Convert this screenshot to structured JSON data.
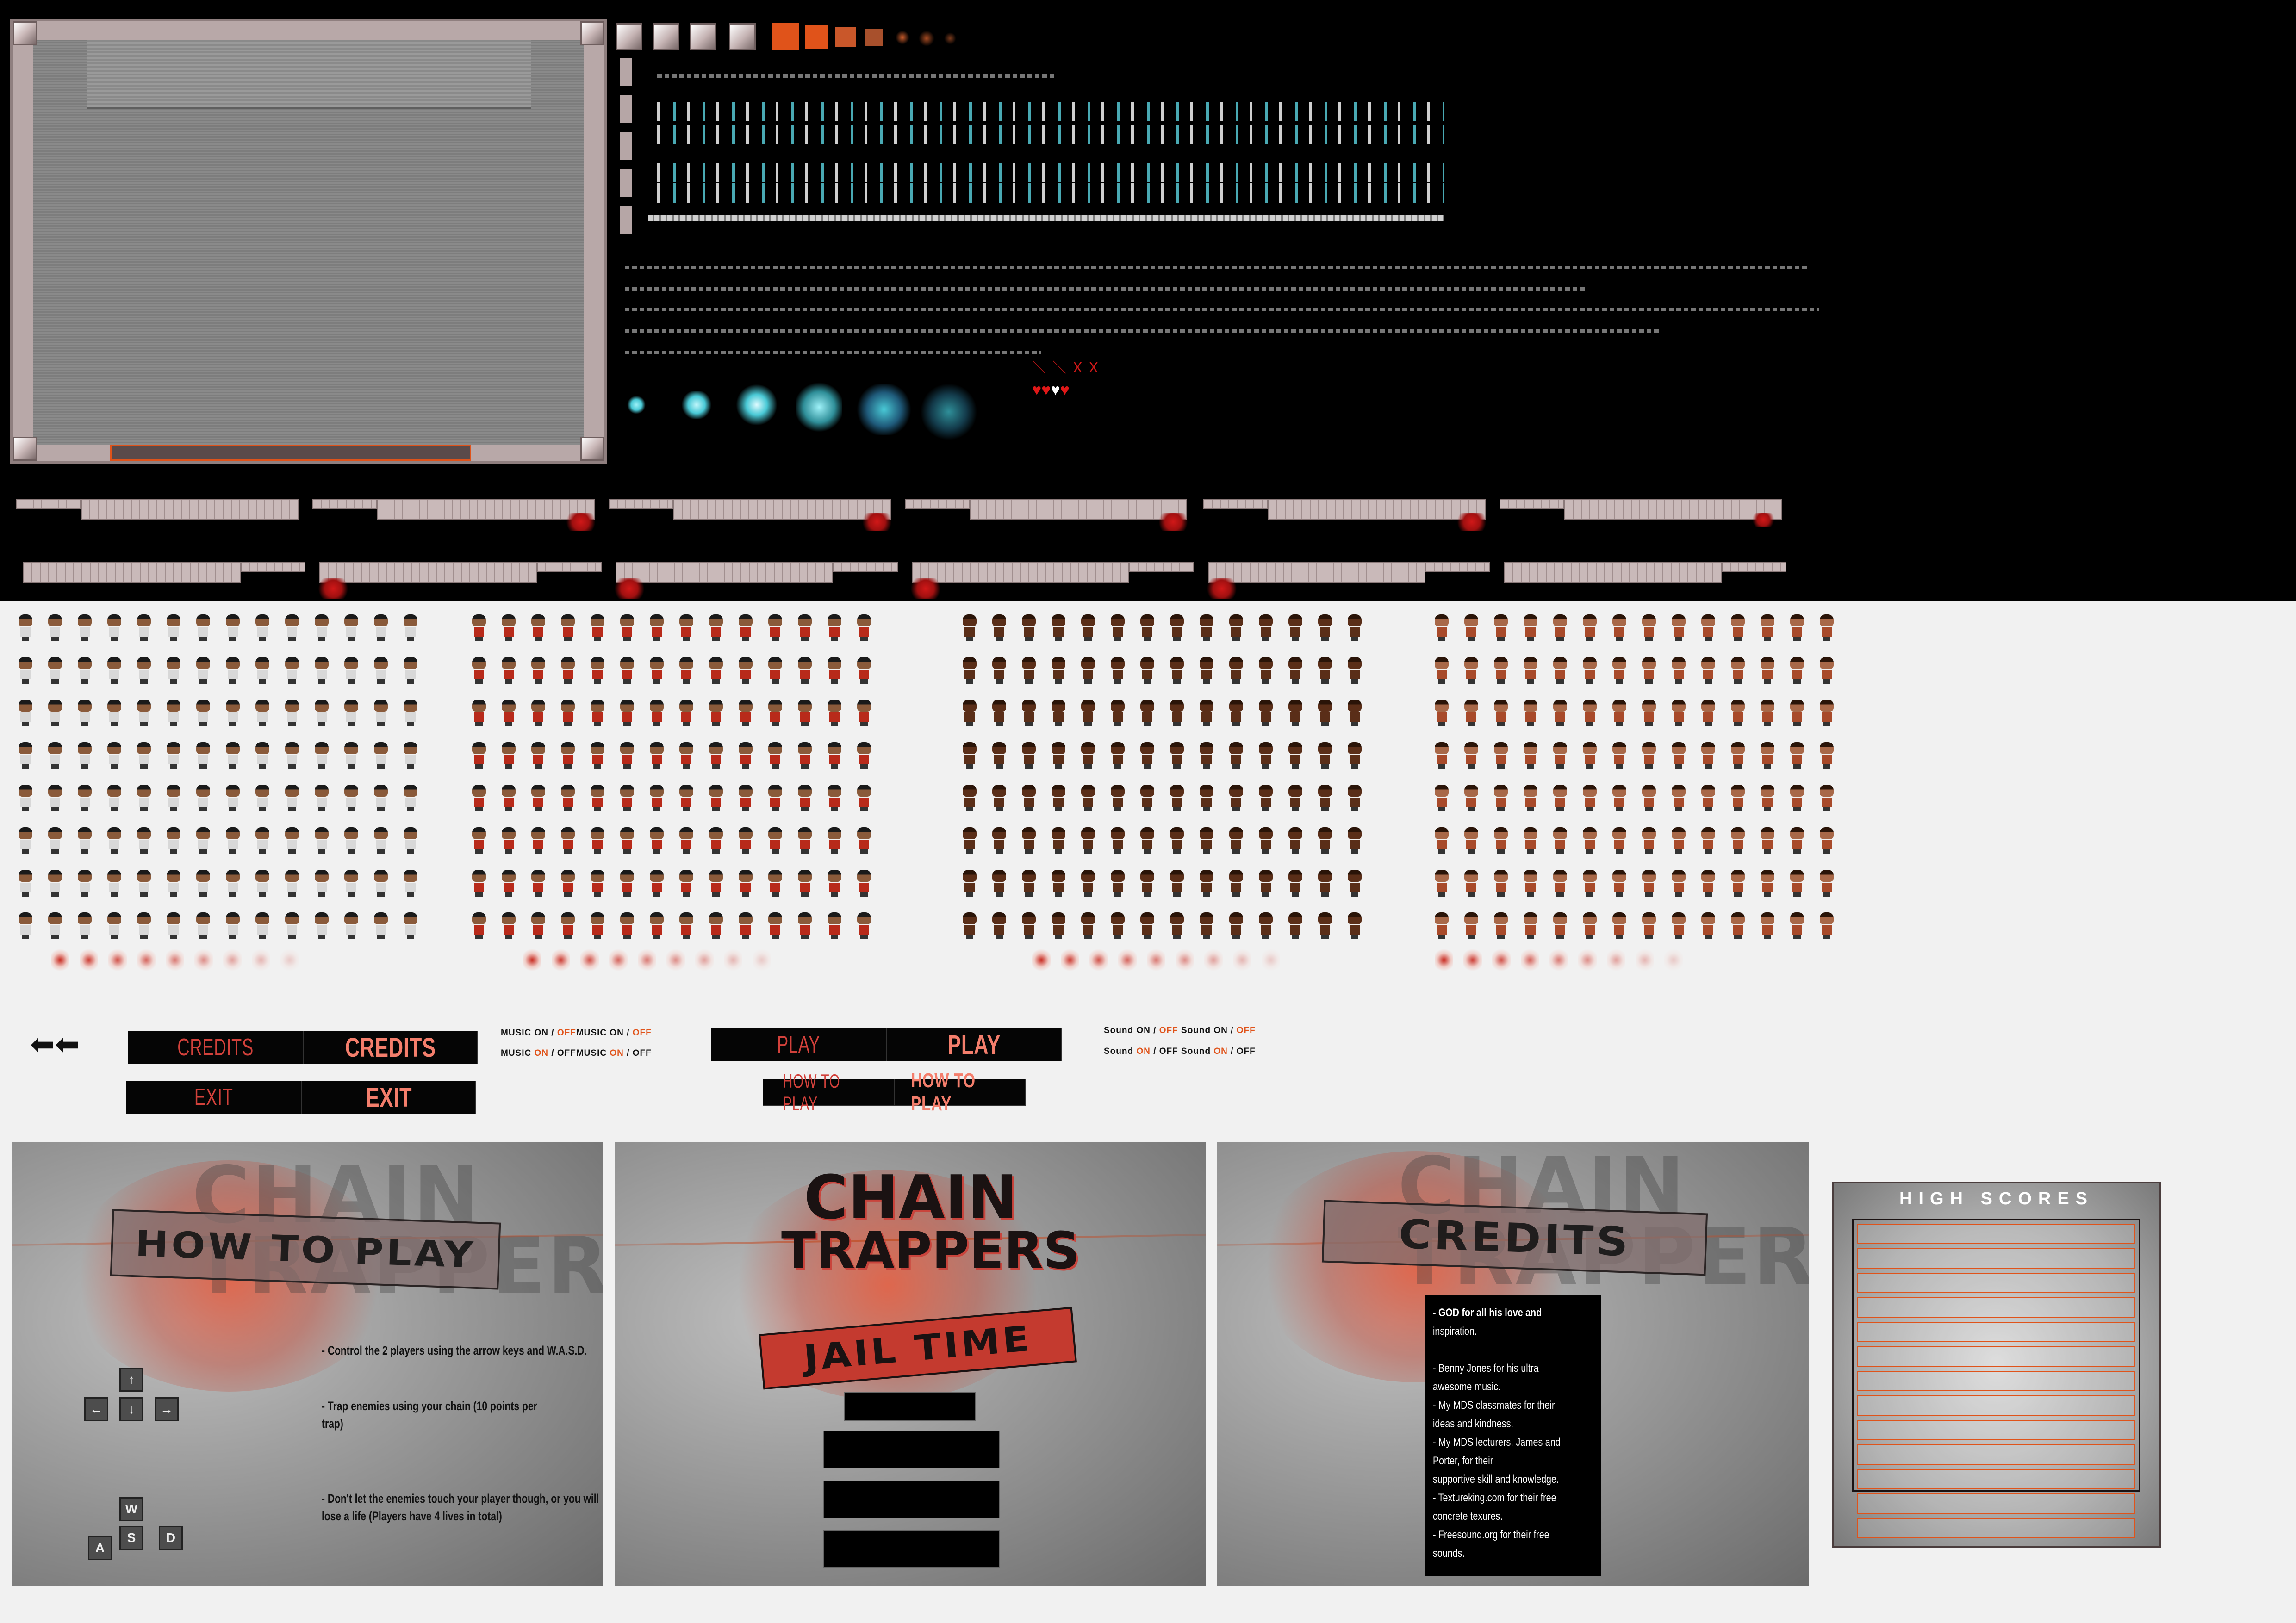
{
  "colors": {
    "accent_orange": "#e0531a",
    "button_red": "#d2413b",
    "button_red_hover": "#f47e6c",
    "cyan_fx": "#49c9d6",
    "sheet_black": "#000000",
    "background": "#f1f1f1"
  },
  "sprites": {
    "groups": [
      "guard-capped",
      "guard-red-shirt",
      "enemy-dark-hair",
      "enemy-red-shirt"
    ],
    "hearts": [
      "heart-red",
      "heart-red",
      "heart-white",
      "heart-red"
    ],
    "chain_fx_icons": [
      "chain-spark-icon",
      "chain-spark-icon",
      "chain-spark-icon",
      "chain-spark-icon",
      "chain-spark-icon",
      "chain-spark-icon"
    ]
  },
  "buttons": {
    "credits": "CREDITS",
    "exit": "EXIT",
    "play": "PLAY",
    "how_to_play": "HOW TO PLAY",
    "back_arrows": "⬅⬅"
  },
  "toggles": {
    "music_label": "MUSIC",
    "sound_label": "Sound",
    "on": "ON",
    "off": "OFF",
    "separator": " / "
  },
  "how_to_play": {
    "title": "HOW TO PLAY",
    "ghost_line1": "CHAIN",
    "ghost_line2": "TRAPPERS",
    "instruction1": "- Control the 2 players using the arrow keys and W.A.S.D.",
    "instruction2": "- Trap enemies using your chain (10 points per trap)",
    "instruction3": "- Don't let the enemies touch your player though, or you will lose a life (Players have 4 lives in total)",
    "keys": {
      "up": "↑",
      "left": "←",
      "down": "↓",
      "right": "→",
      "w": "W",
      "a": "A",
      "s": "S",
      "d": "D"
    }
  },
  "main_menu": {
    "logo_line1": "CHAIN",
    "logo_line2": "TRAPPERS",
    "logo_sub": "JAIL TIME"
  },
  "credits": {
    "title": "CREDITS",
    "ghost_line1": "CHAIN",
    "ghost_line2": "TRAPPERS",
    "lines": [
      "- GOD for all his love and",
      "inspiration.",
      "",
      "- Benny Jones for his ultra",
      "awesome music.",
      "- My MDS classmates for their",
      "ideas and kindness.",
      "- My MDS lecturers, James and",
      "Porter, for their",
      "supportive skill and knowledge.",
      "- Textureking.com for their free",
      "concrete texures.",
      "- Freesound.org for their free",
      "sounds."
    ]
  },
  "high_scores": {
    "title": "HIGH SCORES",
    "rows": [
      "",
      "",
      "",
      "",
      "",
      "",
      "",
      "",
      "",
      "",
      "",
      "",
      ""
    ]
  }
}
